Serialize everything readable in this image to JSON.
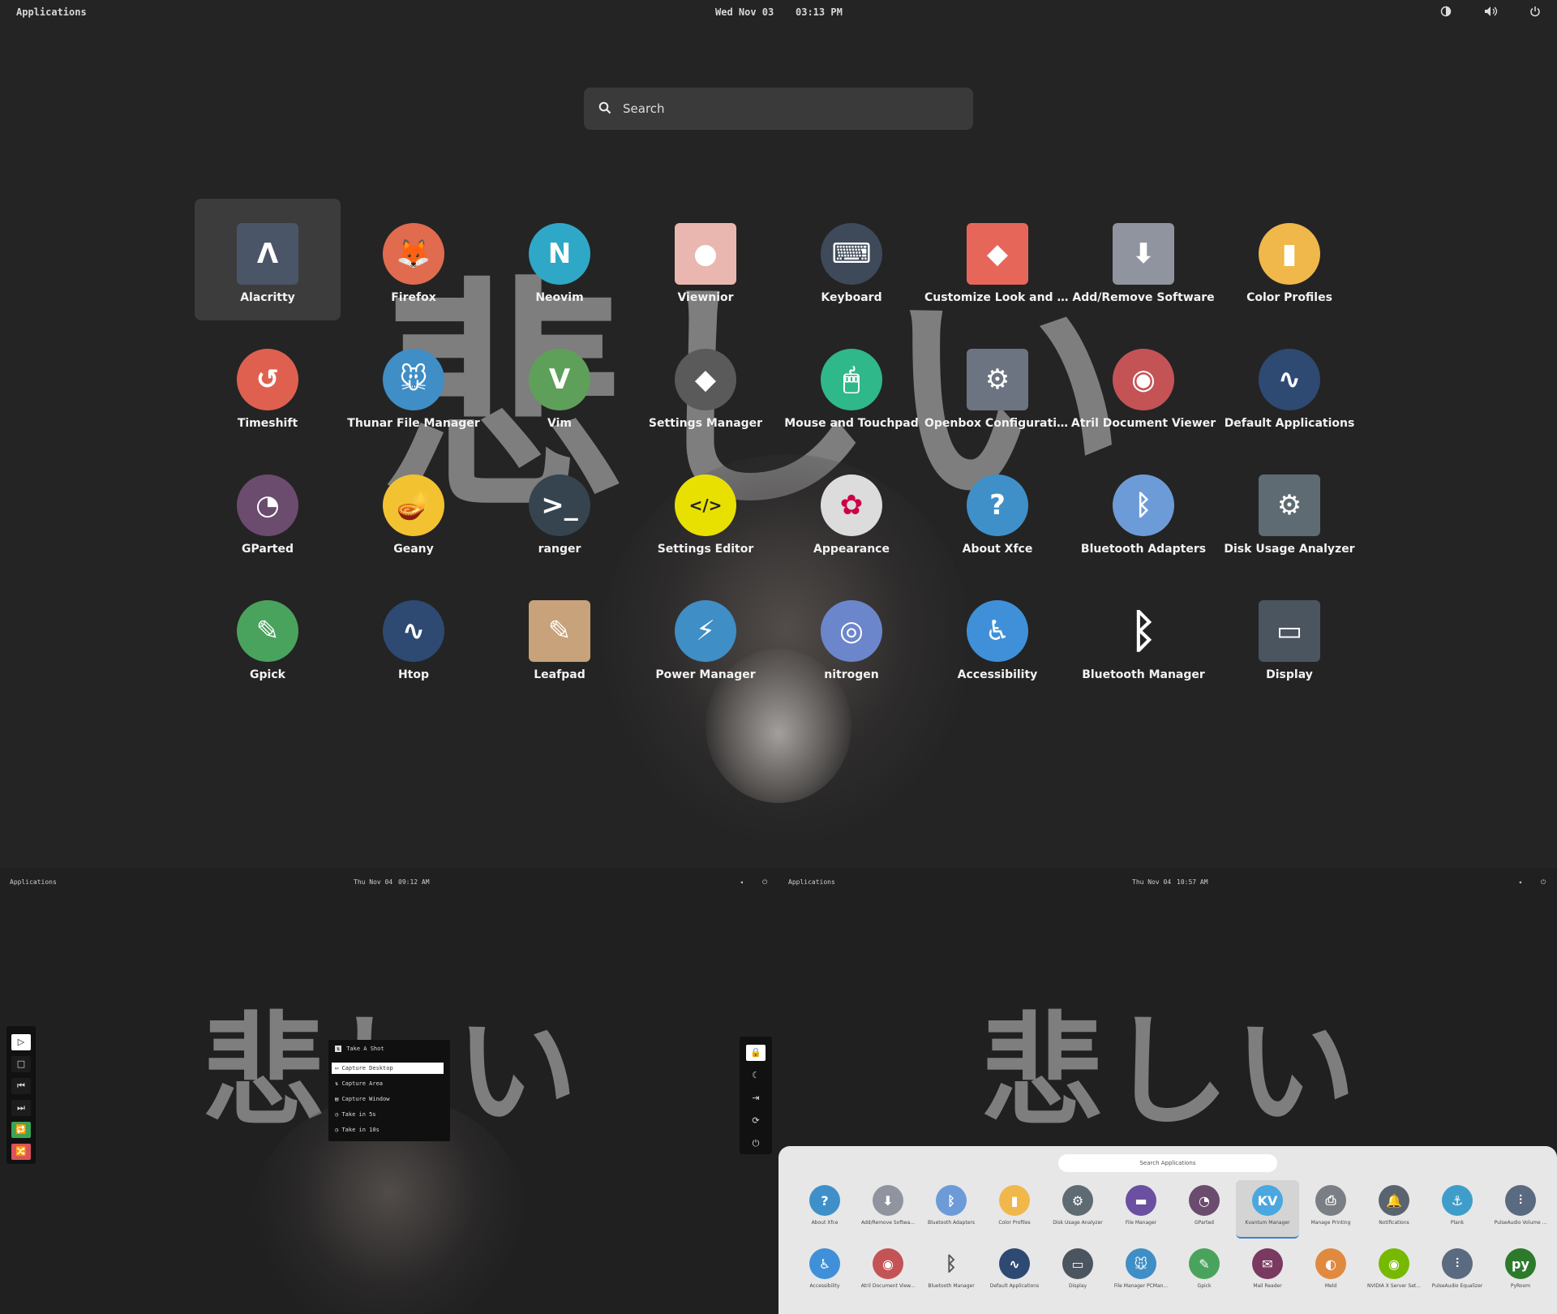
{
  "main": {
    "topbar": {
      "applications": "Applications",
      "date": "Wed Nov 03",
      "time": "03:13 PM"
    },
    "search_placeholder": "Search",
    "wallpaper_text": "悲しい",
    "apps": [
      {
        "label": "Alacritty",
        "icon": "alacritty-icon",
        "color": "#4a5568",
        "glyph": "Λ",
        "selected": true
      },
      {
        "label": "Firefox",
        "icon": "firefox-icon",
        "color": "#e06b4f",
        "glyph": "🦊"
      },
      {
        "label": "Neovim",
        "icon": "neovim-icon",
        "color": "#2fa8c7",
        "glyph": "N"
      },
      {
        "label": "Viewnior",
        "icon": "viewnior-icon",
        "color": "#e9b7b0",
        "glyph": "●"
      },
      {
        "label": "Keyboard",
        "icon": "keyboard-icon",
        "color": "#3e4a5a",
        "glyph": "⌨"
      },
      {
        "label": "Customize Look and Fe...",
        "icon": "customize-look-icon",
        "color": "#e6665a",
        "glyph": "◆"
      },
      {
        "label": "Add/Remove Software",
        "icon": "add-remove-software-icon",
        "color": "#8f949e",
        "glyph": "⬇"
      },
      {
        "label": "Color Profiles",
        "icon": "color-profiles-icon",
        "color": "#f0b84a",
        "glyph": "▮"
      },
      {
        "label": "Timeshift",
        "icon": "timeshift-icon",
        "color": "#e0604f",
        "glyph": "↺"
      },
      {
        "label": "Thunar File Manager",
        "icon": "thunar-icon",
        "color": "#3f8ec6",
        "glyph": "🐭"
      },
      {
        "label": "Vim",
        "icon": "vim-icon",
        "color": "#5ea05a",
        "glyph": "V"
      },
      {
        "label": "Settings Manager",
        "icon": "settings-manager-icon",
        "color": "#5a5a5a",
        "glyph": "◆"
      },
      {
        "label": "Mouse and Touchpad",
        "icon": "mouse-icon",
        "color": "#2fb88a",
        "glyph": "🖱"
      },
      {
        "label": "Openbox Configuratio...",
        "icon": "openbox-icon",
        "color": "#6b7480",
        "glyph": "⚙"
      },
      {
        "label": "Atril Document Viewer",
        "icon": "atril-icon",
        "color": "#c45356",
        "glyph": "◉"
      },
      {
        "label": "Default Applications",
        "icon": "default-apps-icon",
        "color": "#2e4a73",
        "glyph": "∿"
      },
      {
        "label": "GParted",
        "icon": "gparted-icon",
        "color": "#6b4b6e",
        "glyph": "◔"
      },
      {
        "label": "Geany",
        "icon": "geany-icon",
        "color": "#f2c230",
        "glyph": "🪔"
      },
      {
        "label": "ranger",
        "icon": "ranger-icon",
        "color": "#35444f",
        "glyph": ">_"
      },
      {
        "label": "Settings Editor",
        "icon": "settings-editor-icon",
        "color": "#e8e000",
        "glyph": "</>"
      },
      {
        "label": "Appearance",
        "icon": "appearance-icon",
        "color": "#dcdcdc",
        "glyph": "✿"
      },
      {
        "label": "About Xfce",
        "icon": "about-xfce-icon",
        "color": "#3f90c9",
        "glyph": "?"
      },
      {
        "label": "Bluetooth Adapters",
        "icon": "bluetooth-adapters-icon",
        "color": "#6d9bd8",
        "glyph": "ᛒ"
      },
      {
        "label": "Disk Usage Analyzer",
        "icon": "disk-usage-icon",
        "color": "#5f6b72",
        "glyph": "⚙"
      },
      {
        "label": "Gpick",
        "icon": "gpick-icon",
        "color": "#4aa35d",
        "glyph": "✎"
      },
      {
        "label": "Htop",
        "icon": "htop-icon",
        "color": "#2e4a73",
        "glyph": "∿"
      },
      {
        "label": "Leafpad",
        "icon": "leafpad-icon",
        "color": "#c8a27a",
        "glyph": "✎"
      },
      {
        "label": "Power Manager",
        "icon": "power-manager-icon",
        "color": "#3f8ec6",
        "glyph": "⚡"
      },
      {
        "label": "nitrogen",
        "icon": "nitrogen-icon",
        "color": "#6c86cc",
        "glyph": "◎"
      },
      {
        "label": "Accessibility",
        "icon": "accessibility-icon",
        "color": "#3f90d9",
        "glyph": "♿"
      },
      {
        "label": "Bluetooth Manager",
        "icon": "bluetooth-manager-icon",
        "color": "transparent",
        "glyph": "ᛒ"
      },
      {
        "label": "Display",
        "icon": "display-icon",
        "color": "#4b5560",
        "glyph": "▭"
      }
    ]
  },
  "bottom_left": {
    "topbar": {
      "applications": "Applications",
      "date": "Thu Nov 04",
      "time": "09:12 AM"
    },
    "screenshot_menu": {
      "title": "Take A Shot",
      "items": [
        "Capture Desktop",
        "Capture Area",
        "Capture Window",
        "Take in 5s",
        "Take in 10s"
      ]
    },
    "media_buttons": [
      "▷",
      "□",
      "⏮",
      "⏭",
      "🔁",
      "🔀"
    ],
    "wallpaper_text": "悲しい"
  },
  "bottom_right": {
    "topbar": {
      "applications": "Applications",
      "date": "Thu Nov 04",
      "time": "10:57 AM"
    },
    "power_buttons": [
      "🔒",
      "☾",
      "⇥",
      "⟳",
      "⏻"
    ],
    "launcher": {
      "search_placeholder": "Search Applications",
      "apps": [
        {
          "label": "About Xfce",
          "icon": "about-xfce-icon",
          "color": "#3f90c9",
          "glyph": "?"
        },
        {
          "label": "Add/Remove Softwa...",
          "icon": "add-remove-software-icon",
          "color": "#8f949e",
          "glyph": "⬇"
        },
        {
          "label": "Bluetooth Adapters",
          "icon": "bluetooth-adapters-icon",
          "color": "#6d9bd8",
          "glyph": "ᛒ"
        },
        {
          "label": "Color Profiles",
          "icon": "color-profiles-icon",
          "color": "#f0b84a",
          "glyph": "▮"
        },
        {
          "label": "Disk Usage Analyzer",
          "icon": "disk-usage-icon",
          "color": "#5f6b72",
          "glyph": "⚙"
        },
        {
          "label": "File Manager",
          "icon": "file-manager-icon",
          "color": "#6b4fa0",
          "glyph": "▬"
        },
        {
          "label": "GParted",
          "icon": "gparted-icon",
          "color": "#6b4b6e",
          "glyph": "◔"
        },
        {
          "label": "Kvantum Manager",
          "icon": "kvantum-icon",
          "color": "#4aa7e0",
          "glyph": "KV",
          "selected": true
        },
        {
          "label": "Manage Printing",
          "icon": "printer-icon",
          "color": "#7a7f86",
          "glyph": "⎙"
        },
        {
          "label": "Notifications",
          "icon": "notifications-icon",
          "color": "#5a6470",
          "glyph": "🔔"
        },
        {
          "label": "Plank",
          "icon": "plank-icon",
          "color": "#3f9ec9",
          "glyph": "⚓"
        },
        {
          "label": "PulseAudio Volume ...",
          "icon": "pulseaudio-volume-icon",
          "color": "#5a6a80",
          "glyph": "⫶"
        },
        {
          "label": "Accessibility",
          "icon": "accessibility-icon",
          "color": "#3f90d9",
          "glyph": "♿"
        },
        {
          "label": "Atril Document View...",
          "icon": "atril-icon",
          "color": "#c45356",
          "glyph": "◉"
        },
        {
          "label": "Bluetooth Manager",
          "icon": "bluetooth-manager-icon",
          "color": "transparent",
          "glyph": "ᛒ"
        },
        {
          "label": "Default Applications",
          "icon": "default-apps-icon",
          "color": "#2e4a73",
          "glyph": "∿"
        },
        {
          "label": "Display",
          "icon": "display-icon",
          "color": "#4b5560",
          "glyph": "▭"
        },
        {
          "label": "File Manager PCMan...",
          "icon": "pcmanfm-icon",
          "color": "#3f8ec6",
          "glyph": "🐭"
        },
        {
          "label": "Gpick",
          "icon": "gpick-icon",
          "color": "#4aa35d",
          "glyph": "✎"
        },
        {
          "label": "Mail Reader",
          "icon": "mail-reader-icon",
          "color": "#7a3a60",
          "glyph": "✉"
        },
        {
          "label": "Meld",
          "icon": "meld-icon",
          "color": "#e08a40",
          "glyph": "◐"
        },
        {
          "label": "NVIDIA X Server Set...",
          "icon": "nvidia-icon",
          "color": "#76b900",
          "glyph": "◉"
        },
        {
          "label": "PulseAudio Equalizer",
          "icon": "pulseaudio-equalizer-icon",
          "color": "#5a6a80",
          "glyph": "⫶"
        },
        {
          "label": "PyRoom",
          "icon": "pyroom-icon",
          "color": "#2d7a2d",
          "glyph": "py"
        }
      ]
    }
  }
}
